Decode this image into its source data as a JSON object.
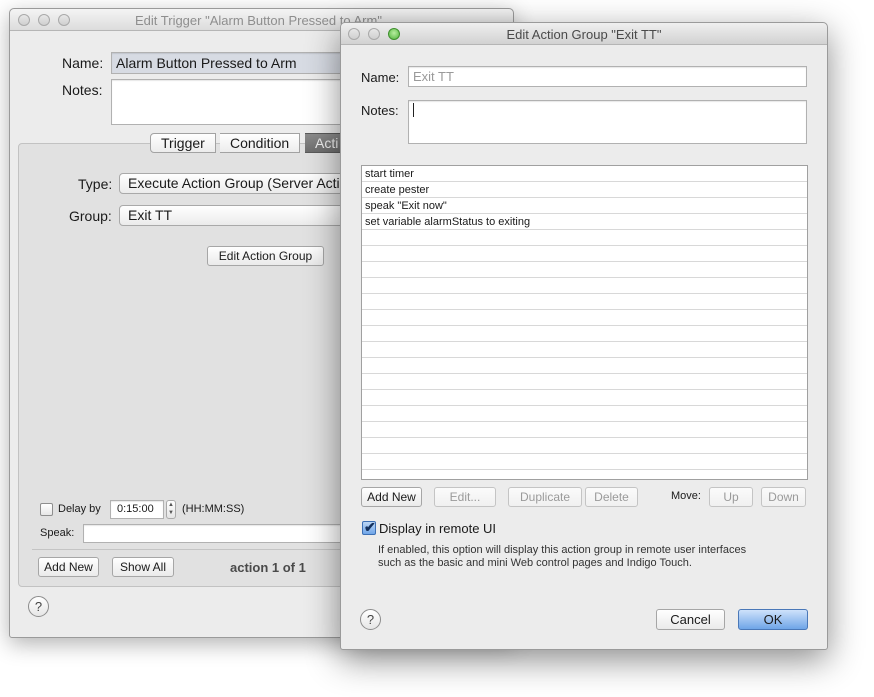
{
  "back_window": {
    "title": "Edit Trigger \"Alarm Button Pressed to Arm\"",
    "name_label": "Name:",
    "name_value": "Alarm Button Pressed to Arm",
    "notes_label": "Notes:",
    "tabs": [
      {
        "label": "Trigger"
      },
      {
        "label": "Condition"
      },
      {
        "label": "Acti"
      }
    ],
    "type_label": "Type:",
    "type_value": "Execute Action Group (Server Acti",
    "group_label": "Group:",
    "group_value": "Exit TT",
    "edit_action_group_label": "Edit Action Group",
    "delay_label": "Delay by",
    "delay_value": "0:15:00",
    "delay_format": "(HH:MM:SS)",
    "speak_label": "Speak:",
    "add_new_label": "Add New",
    "show_all_label": "Show All",
    "action_counter": "action 1 of 1",
    "help_label": "?"
  },
  "front_window": {
    "title": "Edit Action Group \"Exit TT\"",
    "name_label": "Name:",
    "name_placeholder": "Exit TT",
    "notes_label": "Notes:",
    "actions": [
      {
        "label": "start timer"
      },
      {
        "label": "create pester"
      },
      {
        "label": "speak \"Exit now\""
      },
      {
        "label": "set variable alarmStatus to exiting"
      }
    ],
    "buttons": {
      "add_new": "Add New",
      "edit": "Edit...",
      "duplicate": "Duplicate",
      "delete": "Delete",
      "move_label": "Move:",
      "up": "Up",
      "down": "Down"
    },
    "display_remote_label": "Display in remote UI",
    "display_remote_checked": true,
    "display_remote_desc_1": "If enabled, this option will display this action group in remote user interfaces",
    "display_remote_desc_2": "such as the basic and mini Web control pages and Indigo Touch.",
    "cancel_label": "Cancel",
    "ok_label": "OK",
    "help_label": "?"
  },
  "colors": {
    "accent": "#6fa5e8",
    "window_bg": "#ececec",
    "tab_selected": "#7a7a7a"
  },
  "icons": {
    "checkmark": "checkmark-icon",
    "stepper": "stepper-icon"
  }
}
